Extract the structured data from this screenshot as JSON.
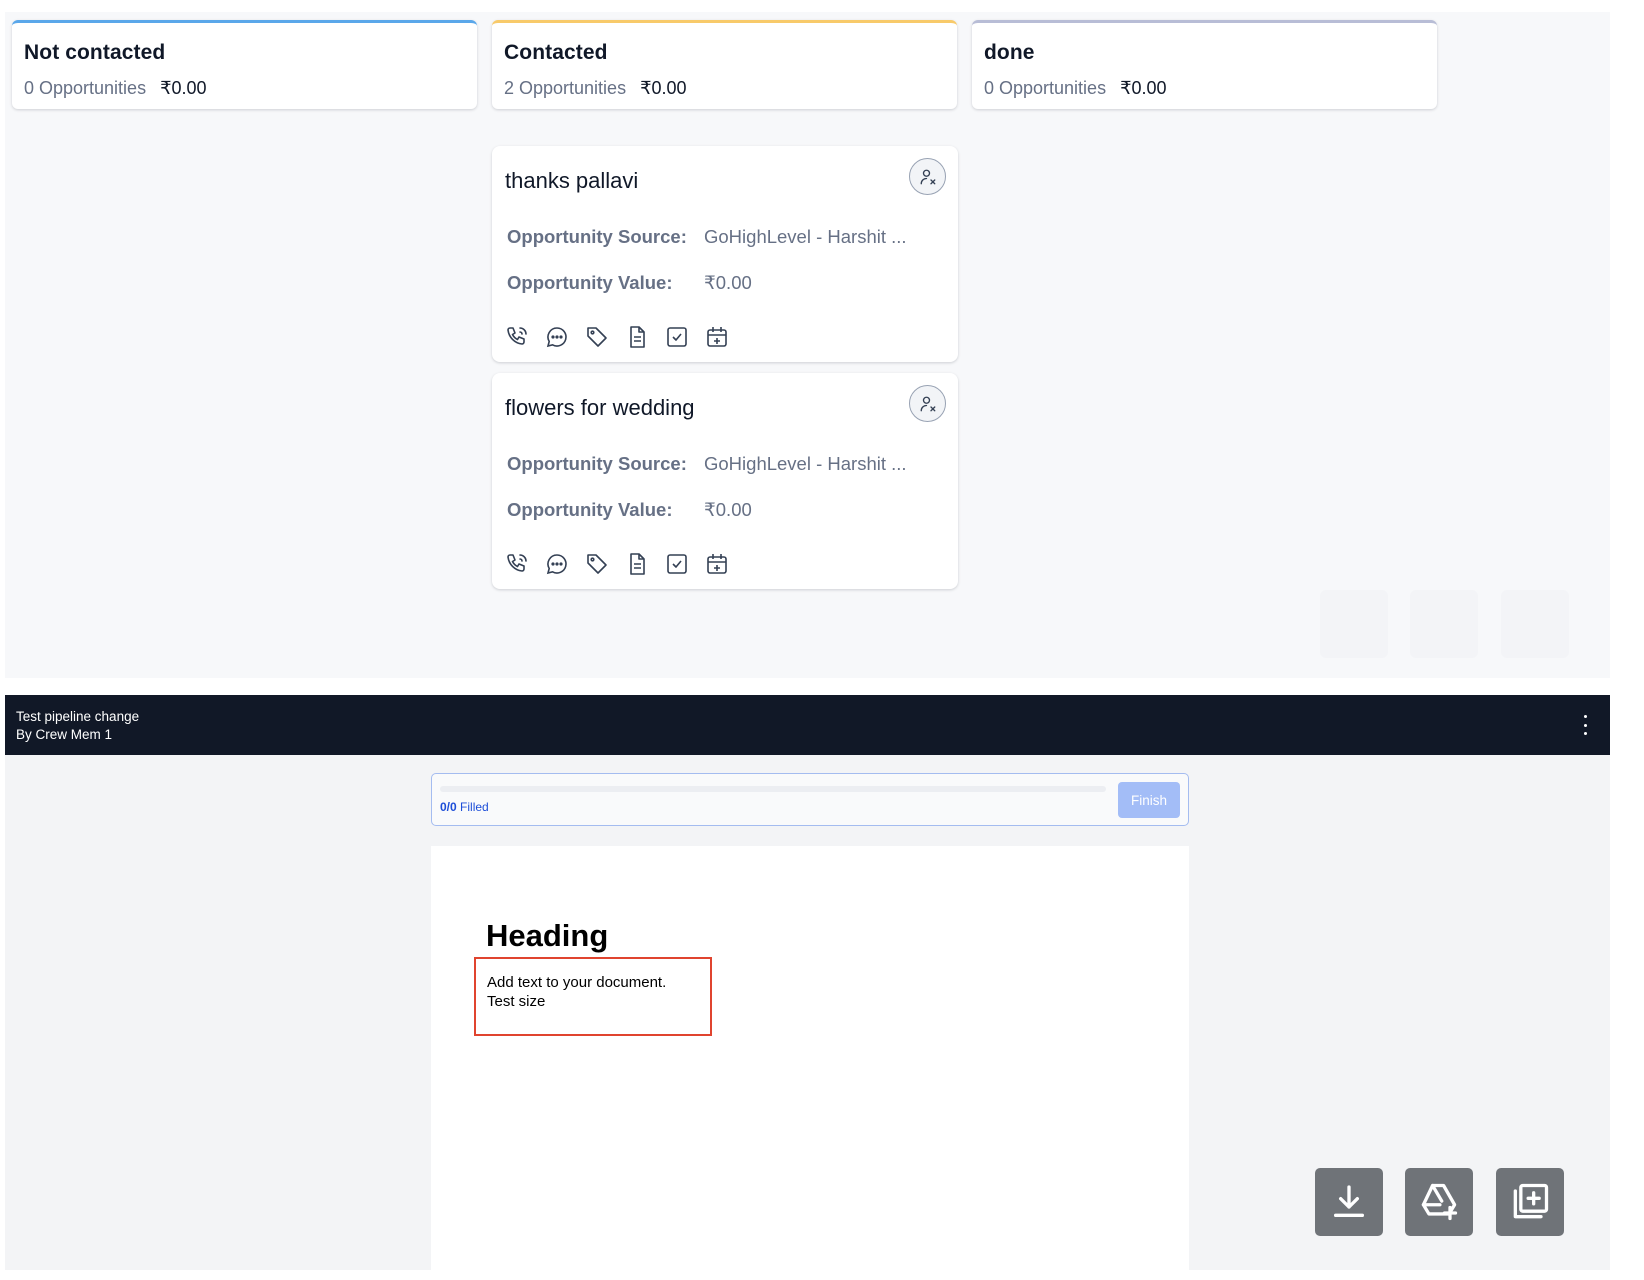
{
  "stages": [
    {
      "title": "Not contacted",
      "count_label": "0 Opportunities",
      "amount": "₹0.00",
      "accent": "#5aa7ea"
    },
    {
      "title": "Contacted",
      "count_label": "2 Opportunities",
      "amount": "₹0.00",
      "accent": "#f8ca6a"
    },
    {
      "title": "done",
      "count_label": "0 Opportunities",
      "amount": "₹0.00",
      "accent": "#b8bdd6"
    }
  ],
  "opportunities": [
    {
      "name": "thanks pallavi",
      "source_label": "Opportunity Source:",
      "source": "GoHighLevel - Harshit ...",
      "value_label": "Opportunity Value:",
      "value": "₹0.00"
    },
    {
      "name": "flowers for wedding",
      "source_label": "Opportunity Source:",
      "source": "GoHighLevel - Harshit ...",
      "value_label": "Opportunity Value:",
      "value": "₹0.00"
    }
  ],
  "card_actions": [
    "phone-icon",
    "chat-icon",
    "tag-icon",
    "note-icon",
    "task-icon",
    "calendar-add-icon"
  ],
  "document": {
    "title": "Test pipeline change",
    "author": "By Crew Mem 1",
    "progress": {
      "filled": "0/0",
      "filled_suffix": "Filled",
      "fraction": 0
    },
    "finish_label": "Finish",
    "heading": "Heading",
    "text_lines": [
      "Add text to your document.",
      "Test size"
    ]
  },
  "floating_actions": [
    "download-icon",
    "drive-add-icon",
    "add-page-icon"
  ],
  "colors": {
    "bar_bg": "#111827",
    "finish_bg": "#a3bdf7",
    "highlight_border": "#e0442f"
  }
}
